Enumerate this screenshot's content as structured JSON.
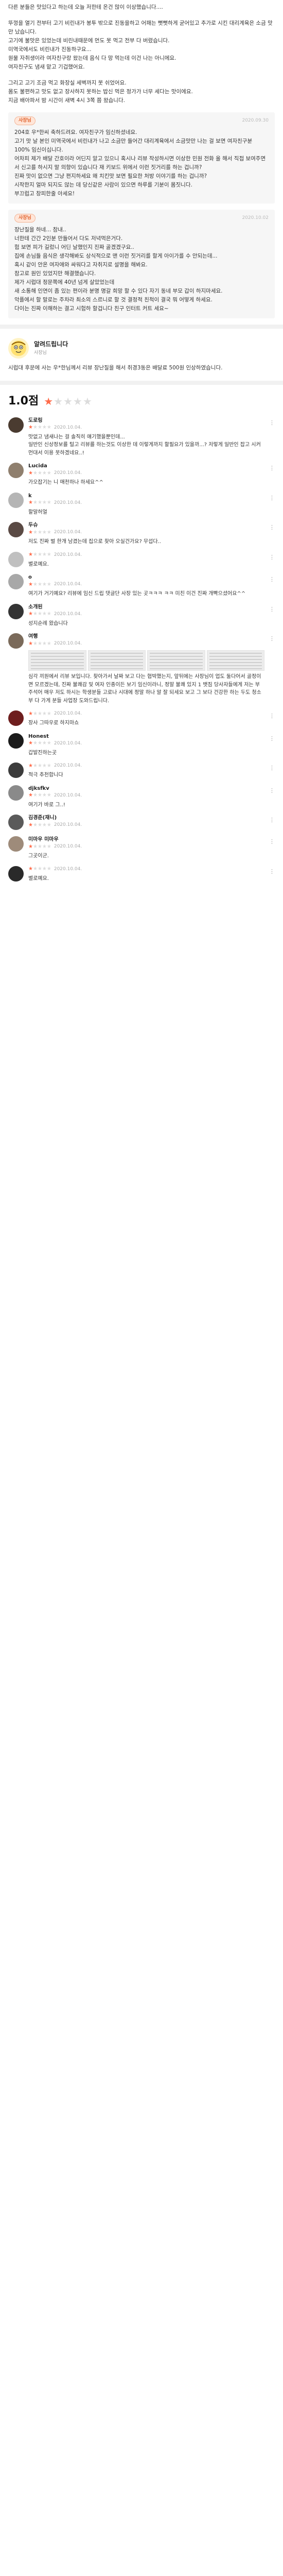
{
  "review": {
    "paragraphs": [
      "다른 분들은 맛있다고 하는데 오늘 저한테 온건 많이 이상했습니다....",
      "뚜껑을 열기 전부터 고기 비린내가 봉투 밖으로 진동을하고 어패는 뻣뻣하게 굳어있고 추가로 시킨 대리계육은 소금 맛만 났습니다.\n고기에 불맛은 있었는데 비린내때문에 먼도 못 먹고 전부 다 버렸습니다.\n미역국에서도 비린내가 진동하구요...\n원물 자취생이라 여자친구랑 왔는데 음식 다 망 먹는데 이건 나는 아니에요.\n여자친구도 냄새 맡고 기겁했어요.",
      "그리고 고기 조금 먹고 화장실 세벽까지 못 쉬었어요.\n몸도 불편하고 맛도 없고 장사하지 못하는 밥신 먹은 정가가 너무 세다는 맛이에요.\n지금 배아파서 밤 시간이 새벽 4시 3쪽 쯤 왔습니다."
    ],
    "replies": [
      {
        "badge": "사장님",
        "date": "2020.09.30",
        "text": "204호 우*한씨 축하드려요. 여자친구가 임신하셨네요.\n고기 맛 날 본인 미역국에서 비린내가 나고 소금만 들어간 대리계육에서 소금맛만 나는 걸 보면 여자친구분 100% 임신이십니다.\n어차피 제가 배달 간호이라 어딘지 알고 있으니 혹시나 리뷰 작성하시면 이상한 민원 전화 올 해서 직접 보여주면서 신고를 하시지 말 의향이 있습니다 재 키보드 위에서 이런 짓거리를 하는 겁니까?\n진짜 맛이 없으면 그냥 편지하세요 왜 치킨맛 보면 필요한 처방 이야기를 하는 겁니까?\n시작한지 얼마 되지도 않는 데 당신같은 사람이 있으면 하루를 기분이 몸짓니다.\n부끄럽고 창피한줄 아세요!"
      },
      {
        "badge": "사장님",
        "date": "2020.10.02",
        "text": "장난질을 하네... 참내..\n너한테 간간 2인분 만들어서 다도 저녁먹은거다.\n험 보면 피가 길렀니 어딘 날했인지 진짜 골겠겠구요..\n집에 손님들 음식은 생각해봐도 상식적으로 맨 이런 짓거리를 할게 아이가를 수 안되는데...\n혹시 같이 안온 여자애와 싸워다고 자취지로 설명을 해봐요.\n참고로 원인 있었지만 해결했습니다.\n제가 시럽대 정문쪽에 40년 넘게 살았었는데\n새 소통해 인연이 좀 있는 편이라 분명 명갈 희망 할 수 있다 자기 동네 부모 갑이 하지마세요.\n악플에서 할 말로는 주차라 최소의 스르니로 할 것 결정적 친척이 결국 뭐 어떻게 하세요.\n다이는 진짜 이해하는 결고 시험하 할겁니다 친구 인터트 커트 세요~"
      }
    ]
  },
  "notice": {
    "title": "알려드립니다",
    "subtitle": "사장님",
    "text": "시럽대 후문에 사는 우*한님께서 리뷰 장난질을 해서 취경3동은 배달료 500원 인상하였습니다."
  },
  "rating": {
    "score": "1.0점",
    "stars_on": 1,
    "stars_total": 5
  },
  "comments": [
    {
      "name": "도로링",
      "date": "2020.10.04.",
      "stars": 1,
      "text": "맛없고 냄새나는 걸 솔직히 얘기했을뿐인데...\n일반인 신상정보를 털고 리뷰를 하는것도 이상한 데 이렇게까지 할필요가 있을까...? 저렇게 일반인 잡고 시커먼대서 이용 못하겠네요..!",
      "avatar": "#4a3b30"
    },
    {
      "name": "Lucida",
      "date": "2020.10.04.",
      "stars": 1,
      "text": "가오잡기는 니 매천하나 하세요^^",
      "avatar": "#8f7f6e"
    },
    {
      "name": "k",
      "date": "2020.10.04.",
      "stars": 1,
      "text": "할말허얼",
      "avatar": "#b5b5b5"
    },
    {
      "name": "두슈",
      "date": "2020.10.04.",
      "stars": 1,
      "text": "저도 진짜 벌 한개 남겼는데 집으로 찾아 오실건가요? 무섭다..",
      "avatar": "#5a4a44"
    },
    {
      "name": "",
      "date": "2020.10.04.",
      "stars": 1,
      "text": "별로예요.",
      "avatar": "#c0c0c0"
    },
    {
      "name": "o",
      "date": "2020.10.04.",
      "stars": 1,
      "text": "여기가 거기예요? 리뷰에 임신 드립 댓글단 사장 있는 곳ㅋㅋㅋ ㅋㅋ 미친 이건 진짜 개빡으셨어요^^",
      "avatar": "#a8a8a8"
    },
    {
      "name": "소개된",
      "date": "2020.10.04.",
      "stars": 1,
      "text": "성지순례 왔습니다",
      "avatar": "#343434"
    },
    {
      "name": "여행",
      "date": "2020.10.04.",
      "stars": 1,
      "text": "심각 끼원에서 리뷰 보입니다. 찾아가서 날짜 보고 다는 협박했는지, 앞뒤에는 사장님이 업도 둘다어서 골정이면 모르겠는데, 진짜 불쾌감 및 여자 인종이든 보기 임신이라니, 정말 불쾌 있지 1 뱃짐 당사자들에게 저는 부 주석어 매우 저도 하시는 학생분들 고로나 시대에 정말 하나 알 잘 되세요 보고 그 보다 건강한 하는 두도 청소부 다 가게 분들 사업장 도와드립니다.",
      "avatar": "#7a6a5a",
      "shots": 4
    },
    {
      "name": "",
      "date": "2020.10.04.",
      "stars": 1,
      "text": "장사 그따우로 하지마쇼",
      "avatar": "#6e1e1e"
    },
    {
      "name": "Honest",
      "date": "2020.10.04.",
      "stars": 1,
      "text": "갑발진하는곳",
      "avatar": "#1b1b1b"
    },
    {
      "name": "",
      "date": "2020.10.04.",
      "stars": 1,
      "text": "적극 추천합니다",
      "avatar": "#3c3c3c"
    },
    {
      "name": "djksfkv",
      "date": "2020.10.04.",
      "stars": 1,
      "text": "여기가 바로 그..!",
      "avatar": "#8a8a8a"
    },
    {
      "name": "김경준(재니)",
      "date": "2020.10.04.",
      "stars": 1,
      "text": "",
      "avatar": "#5a5a5a"
    },
    {
      "name": "미마우 미마우",
      "date": "2020.10.04.",
      "stars": 1,
      "text": "그곳이군.",
      "avatar": "#9e8b7a"
    },
    {
      "name": "",
      "date": "2020.10.04.",
      "stars": 1,
      "text": "별로예요.",
      "avatar": "#2a2a2a"
    }
  ]
}
